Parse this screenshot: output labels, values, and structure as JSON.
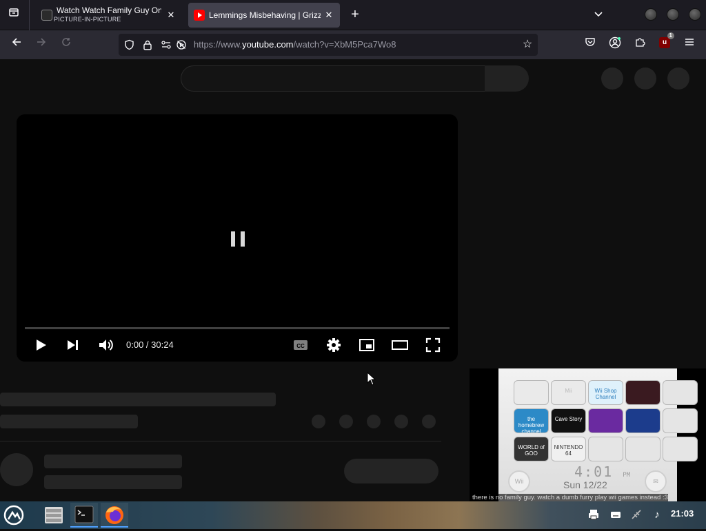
{
  "browser": {
    "tabs": [
      {
        "title": "Watch Watch Family Guy Onlin",
        "subtitle": "PICTURE-IN-PICTURE",
        "active": false,
        "favicon": "family-guy-favicon"
      },
      {
        "title": "Lemmings Misbehaving | Grizz",
        "active": true,
        "favicon": "youtube-favicon"
      }
    ],
    "url": {
      "prefix": "https://www.",
      "host": "youtube.com",
      "path": "/watch?v=XbM5Pca7Wo8"
    },
    "extension_badge": {
      "letter": "u",
      "count": "1"
    }
  },
  "player": {
    "time": "0:00 / 30:24",
    "progress_fraction": 0.0,
    "state": "paused-indicator"
  },
  "pip": {
    "caption": "there is no family guy. watch a dumb furry play wii games instead :3",
    "wii_time": "4:01",
    "wii_ampm": "PM",
    "wii_date": "Sun 12/22",
    "channels": [
      "",
      "Mii",
      "Wii Shop Channel",
      "",
      "",
      "the homebrew channel",
      "Cave Story",
      "",
      "",
      "",
      "WORLD of GOO",
      "NINTENDO 64",
      "",
      "",
      ""
    ],
    "wii_button_label": "Wii"
  },
  "taskbar": {
    "clock": "21:03"
  }
}
